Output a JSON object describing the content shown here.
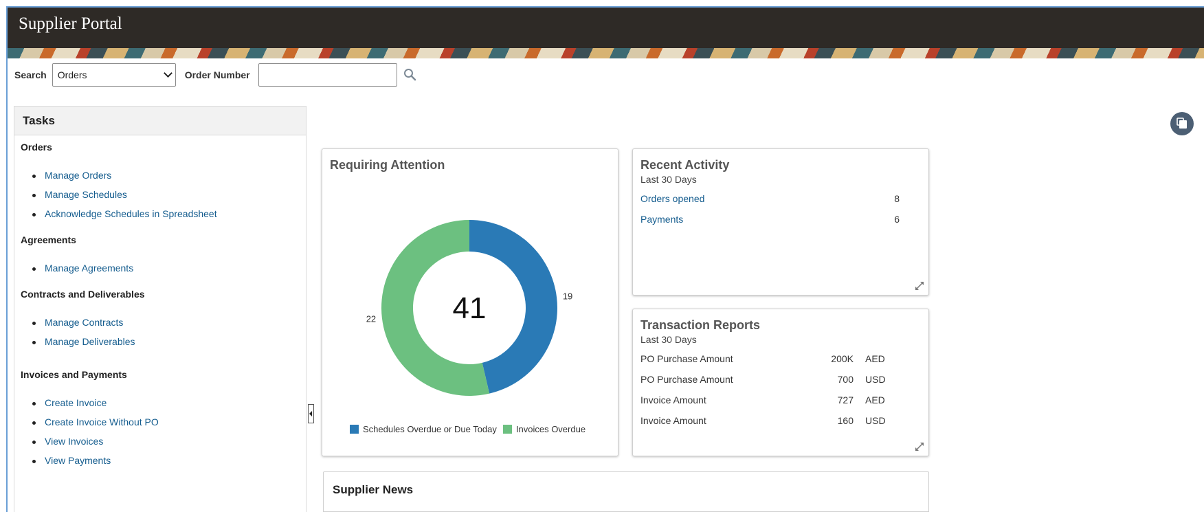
{
  "app": {
    "title": "Supplier Portal"
  },
  "search": {
    "label": "Search",
    "selected": "Orders",
    "field_label": "Order Number",
    "field_value": ""
  },
  "tasks": {
    "title": "Tasks",
    "sections": [
      {
        "title": "Orders",
        "links": [
          "Manage Orders",
          "Manage Schedules",
          "Acknowledge Schedules in Spreadsheet"
        ]
      },
      {
        "title": "Agreements",
        "links": [
          "Manage Agreements"
        ]
      },
      {
        "title": "Contracts and Deliverables",
        "links": [
          "Manage Contracts",
          "Manage Deliverables"
        ]
      },
      {
        "title": "Invoices and Payments",
        "links": [
          "Create Invoice",
          "Create Invoice Without PO",
          "View Invoices",
          "View Payments"
        ]
      }
    ]
  },
  "requiring_attention": {
    "title": "Requiring Attention",
    "total": "41",
    "colors": {
      "schedules": "#2a7ab6",
      "invoices": "#6cc080"
    }
  },
  "chart_data": {
    "type": "pie",
    "title": "Requiring Attention",
    "center_label": "41",
    "series": [
      {
        "name": "Schedules Overdue or Due Today",
        "value": 19,
        "label": "19"
      },
      {
        "name": "Invoices Overdue",
        "value": 22,
        "label": "22"
      }
    ],
    "legend_position": "bottom"
  },
  "recent_activity": {
    "title": "Recent Activity",
    "subtitle": "Last 30 Days",
    "items": [
      {
        "label": "Orders opened",
        "count": "8"
      },
      {
        "label": "Payments",
        "count": "6"
      }
    ]
  },
  "transaction_reports": {
    "title": "Transaction Reports",
    "subtitle": "Last 30 Days",
    "rows": [
      {
        "label": "PO Purchase Amount",
        "amount": "200K",
        "currency": "AED"
      },
      {
        "label": "PO Purchase Amount",
        "amount": "700",
        "currency": "USD"
      },
      {
        "label": "Invoice Amount",
        "amount": "727",
        "currency": "AED"
      },
      {
        "label": "Invoice Amount",
        "amount": "160",
        "currency": "USD"
      }
    ]
  },
  "supplier_news": {
    "title": "Supplier News"
  },
  "icons": {
    "search": "search-icon",
    "expand": "expand-icon",
    "collapse": "collapse-panel-icon",
    "floating": "stacked-pages-icon"
  }
}
